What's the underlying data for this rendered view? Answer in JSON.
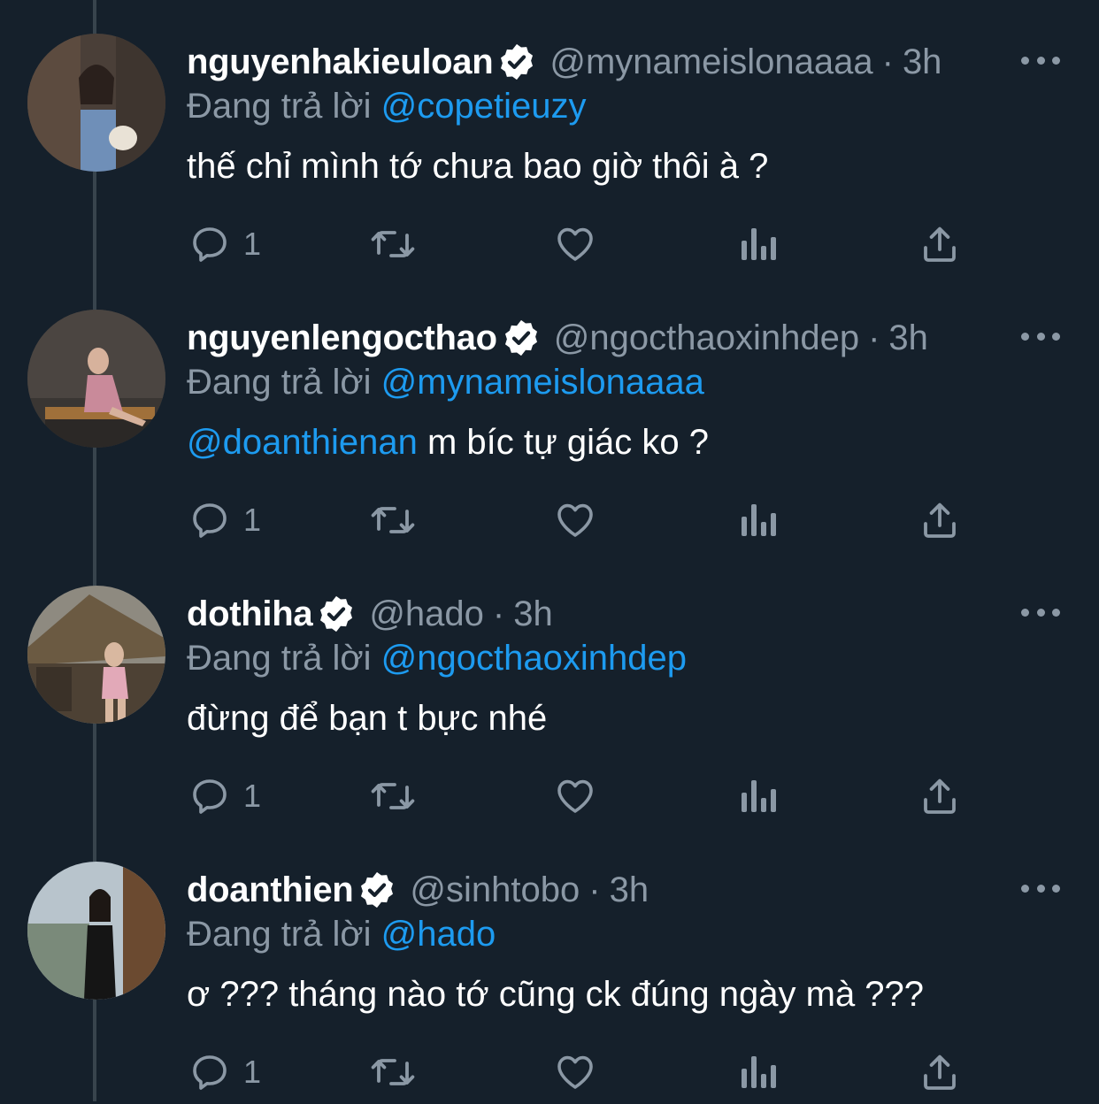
{
  "colors": {
    "background": "#15202b",
    "text": "#ffffff",
    "secondary": "#8b98a5",
    "link": "#1d9bf0",
    "thread_line": "#38444d"
  },
  "tweets": [
    {
      "display_name": "nguyenhakieuloan",
      "handle": "@mynameislonaaaa",
      "dot": "·",
      "time": "3h",
      "replying_label": "Đang trả lời",
      "replying_to": "@copetieuzy",
      "text_mention": "",
      "text": "thế chỉ mình tớ chưa bao giờ thôi à ?",
      "reply_count": "1",
      "verified": true
    },
    {
      "display_name": "nguyenlengocthao",
      "handle": "@ngocthaoxinhdep",
      "dot": "·",
      "time": "3h",
      "replying_label": "Đang trả lời",
      "replying_to": "@mynameislonaaaa",
      "text_mention": "@doanthienan",
      "text": " m bíc tự giác ko ?",
      "reply_count": "1",
      "verified": true
    },
    {
      "display_name": "dothiha",
      "handle": "@hado",
      "dot": "·",
      "time": "3h",
      "replying_label": "Đang trả lời",
      "replying_to": "@ngocthaoxinhdep",
      "text_mention": "",
      "text": "đừng để bạn t bực nhé",
      "reply_count": "1",
      "verified": true
    },
    {
      "display_name": "doanthien",
      "handle": "@sinhtobo",
      "dot": "·",
      "time": "3h",
      "replying_label": "Đang trả lời",
      "replying_to": "@hado",
      "text_mention": "",
      "text": "ơ ??? tháng nào tớ cũng ck đúng ngày mà ???",
      "reply_count": "1",
      "verified": true
    }
  ],
  "icons": {
    "reply": "reply-icon",
    "retweet": "retweet-icon",
    "like": "heart-icon",
    "views": "analytics-icon",
    "share": "share-icon",
    "more": "more-icon",
    "verified": "verified-badge-icon"
  }
}
